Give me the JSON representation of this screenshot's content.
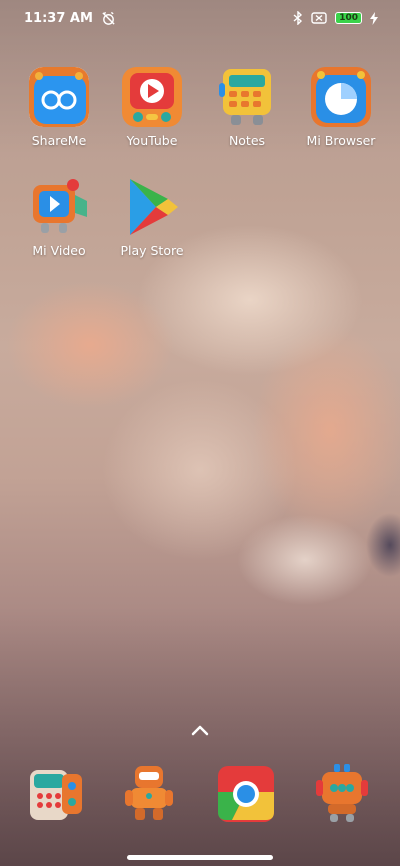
{
  "status_bar": {
    "time": "11:37 AM",
    "battery_level": "100",
    "icons": [
      "alarm-off-icon",
      "bluetooth-icon",
      "no-sim-icon",
      "battery-icon",
      "charging-icon"
    ]
  },
  "apps": [
    {
      "label": "ShareMe",
      "icon": "shareme-icon"
    },
    {
      "label": "YouTube",
      "icon": "youtube-icon"
    },
    {
      "label": "Notes",
      "icon": "notes-icon"
    },
    {
      "label": "Mi Browser",
      "icon": "mi-browser-icon"
    },
    {
      "label": "Mi Video",
      "icon": "mi-video-icon"
    },
    {
      "label": "Play Store",
      "icon": "play-store-icon"
    }
  ],
  "dock": {
    "icons": [
      "phone-icon",
      "messages-icon",
      "chrome-icon",
      "camera-icon"
    ]
  },
  "colors": {
    "battery": "#3ad34a",
    "clay_orange": "#e8762e",
    "clay_blue": "#2a8fe6",
    "clay_teal": "#2aa8a0"
  }
}
